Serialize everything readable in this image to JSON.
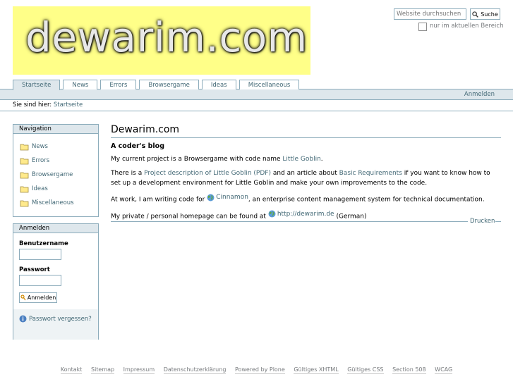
{
  "logo": {
    "text": "dewarim.com"
  },
  "search": {
    "placeholder": "Website durchsuchen",
    "button_label": "Suche",
    "section_label": "nur im aktuellen Bereich"
  },
  "tabs": [
    {
      "label": "Startseite",
      "active": true
    },
    {
      "label": "News"
    },
    {
      "label": "Errors"
    },
    {
      "label": "Browsergame"
    },
    {
      "label": "Ideas"
    },
    {
      "label": "Miscellaneous"
    }
  ],
  "personal_bar": {
    "login_label": "Anmelden"
  },
  "breadcrumb": {
    "prefix": "Sie sind hier:",
    "home": "Startseite"
  },
  "navigation": {
    "title": "Navigation",
    "items": [
      "News",
      "Errors",
      "Browsergame",
      "Ideas",
      "Miscellaneous"
    ]
  },
  "login": {
    "title": "Anmelden",
    "username_label": "Benutzername",
    "password_label": "Passwort",
    "button_label": "Anmelden",
    "forgot_label": "Passwort vergessen?"
  },
  "content": {
    "title": "Dewarim.com",
    "heading": "A coder's blog",
    "p1_pre": "My current project is a Browsergame with code name ",
    "p1_link": "Little Goblin",
    "p1_post": ".",
    "p2_pre": "There is a ",
    "p2_link1": "Project description of Little Goblin (PDF)",
    "p2_mid": " and an article about ",
    "p2_link2": "Basic Requirements",
    "p2_post": " if you want to know how to set up a development environment for Little Goblin and make your own improvements to the code.",
    "p3_pre": "At work, I am writing code for ",
    "p3_link": "Cinnamon",
    "p3_post": ", an enterprise content management system for technical documentation.",
    "p4_pre": "My private / personal homepage can be found at ",
    "p4_link": "http://dewarim.de",
    "p4_post": " (German)",
    "print_label": "Drucken"
  },
  "footer": [
    "Kontakt",
    "Sitemap",
    "Impressum",
    "Datenschutzerklärung",
    "Powered by Plone",
    "Gültiges XHTML",
    "Gültiges CSS",
    "Section 508",
    "WCAG"
  ],
  "colors": {
    "accent": "#8cacbb",
    "link": "#436976",
    "tab_bg": "#dee7ec",
    "logo_bg": "#ffff88"
  }
}
